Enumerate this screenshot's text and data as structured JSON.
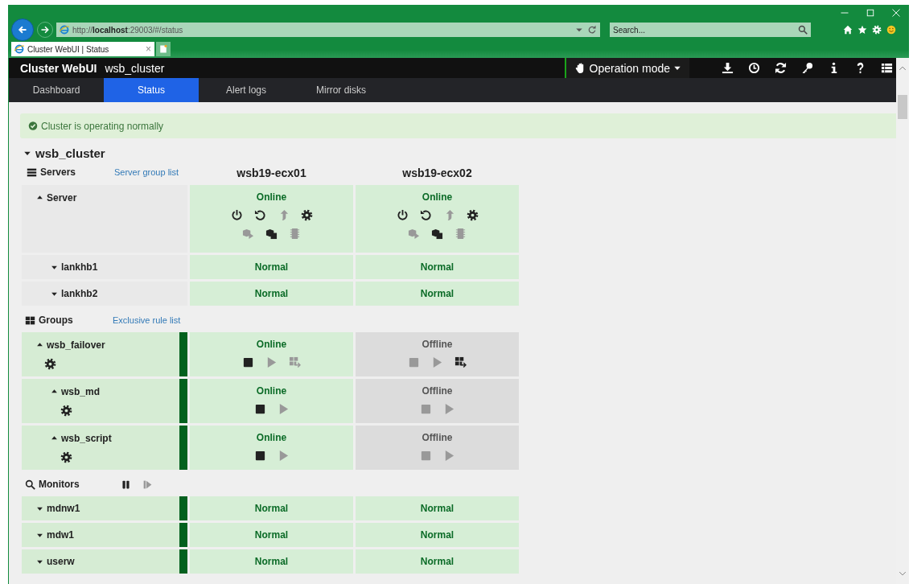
{
  "browser": {
    "address": "http://**localhost**:29003/#/status",
    "search_placeholder": "Search...",
    "tab": {
      "title": "Cluster WebUI | Status",
      "close": "×"
    }
  },
  "app": {
    "brand": "Cluster WebUI",
    "cluster": "wsb_cluster",
    "mode_button": "Operation mode"
  },
  "nav": [
    {
      "label": "Dashboard",
      "selected": false
    },
    {
      "label": "Status",
      "selected": true
    },
    {
      "label": "Alert logs",
      "selected": false
    },
    {
      "label": "Mirror disks",
      "selected": false
    }
  ],
  "alert": {
    "text": "Cluster is operating normally"
  },
  "cluster": {
    "name": "wsb_cluster"
  },
  "servers": {
    "title": "Servers",
    "link": "Server group list",
    "columns": [
      "wsb19-ecx01",
      "wsb19-ecx02"
    ],
    "rows": [
      {
        "name": "Server",
        "expanded": true,
        "cells": [
          {
            "status": "Online",
            "healthy": true,
            "action_rows": [
              [
                {
                  "kind": "power",
                  "disabled": false
                },
                {
                  "kind": "restart",
                  "disabled": false
                },
                {
                  "kind": "up",
                  "disabled": true
                },
                {
                  "kind": "settings",
                  "disabled": false
                }
              ],
              [
                {
                  "kind": "boxplay",
                  "disabled": true
                },
                {
                  "kind": "boxes",
                  "disabled": false
                },
                {
                  "kind": "chip",
                  "disabled": true
                }
              ]
            ]
          },
          {
            "status": "Online",
            "healthy": true,
            "action_rows": [
              [
                {
                  "kind": "power",
                  "disabled": false
                },
                {
                  "kind": "restart",
                  "disabled": false
                },
                {
                  "kind": "up",
                  "disabled": true
                },
                {
                  "kind": "settings",
                  "disabled": false
                }
              ],
              [
                {
                  "kind": "boxplay",
                  "disabled": true
                },
                {
                  "kind": "boxes",
                  "disabled": false
                },
                {
                  "kind": "chip",
                  "disabled": true
                }
              ]
            ]
          }
        ],
        "children": [
          {
            "name": "lankhb1",
            "expanded": false,
            "cells": [
              {
                "status": "Normal",
                "healthy": true
              },
              {
                "status": "Normal",
                "healthy": true
              }
            ]
          },
          {
            "name": "lankhb2",
            "expanded": false,
            "cells": [
              {
                "status": "Normal",
                "healthy": true
              },
              {
                "status": "Normal",
                "healthy": true
              }
            ]
          }
        ]
      }
    ]
  },
  "groups": {
    "title": "Groups",
    "link": "Exclusive rule list",
    "rows": [
      {
        "name": "wsb_failover",
        "expanded": true,
        "healthy": true,
        "name_actions": [
          {
            "kind": "settings",
            "disabled": false
          }
        ],
        "cells": [
          {
            "status": "Online",
            "healthy": true,
            "action_rows": [
              [
                {
                  "kind": "stop",
                  "disabled": false
                },
                {
                  "kind": "play",
                  "disabled": true
                },
                {
                  "kind": "move",
                  "disabled": true
                }
              ]
            ]
          },
          {
            "status": "Offline",
            "healthy": false,
            "action_rows": [
              [
                {
                  "kind": "stop",
                  "disabled": true
                },
                {
                  "kind": "play",
                  "disabled": true
                },
                {
                  "kind": "move",
                  "disabled": false
                }
              ]
            ]
          }
        ],
        "children": [
          {
            "name": "wsb_md",
            "expanded": true,
            "healthy": true,
            "name_actions": [
              {
                "kind": "settings",
                "disabled": false
              }
            ],
            "cells": [
              {
                "status": "Online",
                "healthy": true,
                "action_rows": [
                  [
                    {
                      "kind": "stop",
                      "disabled": false
                    },
                    {
                      "kind": "play",
                      "disabled": true
                    }
                  ]
                ]
              },
              {
                "status": "Offline",
                "healthy": false,
                "action_rows": [
                  [
                    {
                      "kind": "stop",
                      "disabled": true
                    },
                    {
                      "kind": "play",
                      "disabled": true
                    }
                  ]
                ]
              }
            ]
          },
          {
            "name": "wsb_script",
            "expanded": true,
            "healthy": true,
            "name_actions": [
              {
                "kind": "settings",
                "disabled": false
              }
            ],
            "cells": [
              {
                "status": "Online",
                "healthy": true,
                "action_rows": [
                  [
                    {
                      "kind": "stop",
                      "disabled": false
                    },
                    {
                      "kind": "play",
                      "disabled": true
                    }
                  ]
                ]
              },
              {
                "status": "Offline",
                "healthy": false,
                "action_rows": [
                  [
                    {
                      "kind": "stop",
                      "disabled": true
                    },
                    {
                      "kind": "play",
                      "disabled": true
                    }
                  ]
                ]
              }
            ]
          }
        ]
      }
    ]
  },
  "monitors": {
    "title": "Monitors",
    "actions": [
      {
        "kind": "pause",
        "disabled": false
      },
      {
        "kind": "resume",
        "disabled": true
      }
    ],
    "rows": [
      {
        "name": "mdnw1",
        "expanded": false,
        "healthy": true,
        "cells": [
          {
            "status": "Normal",
            "healthy": true
          },
          {
            "status": "Normal",
            "healthy": true
          }
        ]
      },
      {
        "name": "mdw1",
        "expanded": false,
        "healthy": true,
        "cells": [
          {
            "status": "Normal",
            "healthy": true
          },
          {
            "status": "Normal",
            "healthy": true
          }
        ]
      },
      {
        "name": "userw",
        "expanded": false,
        "healthy": true,
        "cells": [
          {
            "status": "Normal",
            "healthy": true
          },
          {
            "status": "Normal",
            "healthy": true
          }
        ]
      }
    ]
  }
}
